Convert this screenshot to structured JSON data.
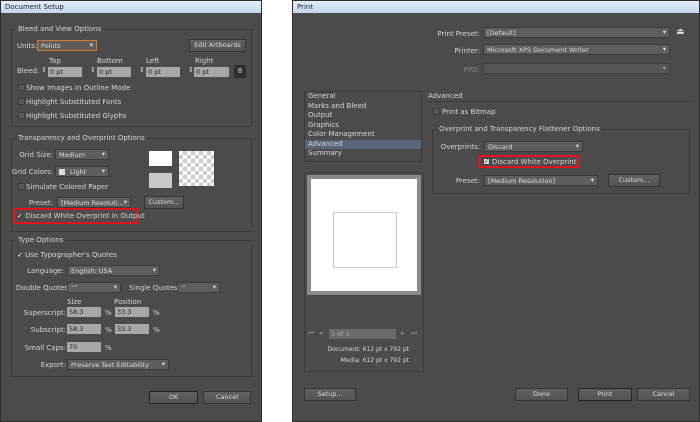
{
  "doc_setup": {
    "title": "Document Setup",
    "bleed_group": "Bleed and View Options",
    "units_label": "Units:",
    "units_value": "Points",
    "edit_artboards": "Edit Artboards",
    "bleed_label": "Bleed:",
    "bleed": [
      {
        "label": "Top",
        "value": "0 pt"
      },
      {
        "label": "Bottom",
        "value": "0 pt"
      },
      {
        "label": "Left",
        "value": "0 pt"
      },
      {
        "label": "Right",
        "value": "0 pt"
      }
    ],
    "checks": [
      "Show Images In Outline Mode",
      "Highlight Substituted Fonts",
      "Highlight Substituted Glyphs"
    ],
    "transp_group": "Transparency and Overprint Options",
    "grid_size_label": "Grid Size:",
    "grid_size": "Medium",
    "grid_colors_label": "Grid Colors:",
    "grid_colors": "Light",
    "simulate": "Simulate Colored Paper",
    "preset_label": "Preset:",
    "preset": "[Medium Resoluti...",
    "custom": "Custom...",
    "discard": "Discard White Overprint in Output",
    "type_group": "Type Options",
    "typographers": "Use Typographer's Quotes",
    "language_label": "Language:",
    "language": "English: USA",
    "dq_label": "Double Quotes:",
    "dq": "“”",
    "sq_label": "Single Quotes:",
    "sq": "‘’",
    "size_label": "Size",
    "position_label": "Position",
    "superscript_label": "Superscript:",
    "sup_size": "58.3",
    "sup_pos": "33.3",
    "subscript_label": "Subscript:",
    "sub_size": "58.3",
    "sub_pos": "33.3",
    "smallcaps_label": "Small Caps:",
    "smallcaps": "70",
    "pct": "%",
    "export_label": "Export:",
    "export": "Preserve Text Editability",
    "ok": "OK",
    "cancel": "Cancel"
  },
  "print": {
    "title": "Print",
    "preset_label": "Print Preset:",
    "preset": "[Default]",
    "printer_label": "Printer:",
    "printer": "Microsoft XPS Document Writer",
    "ppd_label": "PPD:",
    "nav": [
      "General",
      "Marks and Bleed",
      "Output",
      "Graphics",
      "Color Management",
      "Advanced",
      "Summary"
    ],
    "selected_nav": "Advanced",
    "page": "1 of 1",
    "document": "Document: 612 pt x 792 pt",
    "media": "Media: 612 pt x 792 pt",
    "section": "Advanced",
    "bitmap": "Print as Bitmap",
    "group": "Overprint and Transparency Flattener Options",
    "overprints_label": "Overprints:",
    "overprints": "Discard",
    "discard": "Discard White Overprint",
    "fpreset_label": "Preset:",
    "fpreset": "[Medium Resolution]",
    "custom": "Custom...",
    "setup": "Setup...",
    "done": "Done",
    "print": "Print",
    "cancel": "Cancel"
  },
  "colors": {
    "highlight": "#e0141e",
    "selected": "#5a6478"
  }
}
